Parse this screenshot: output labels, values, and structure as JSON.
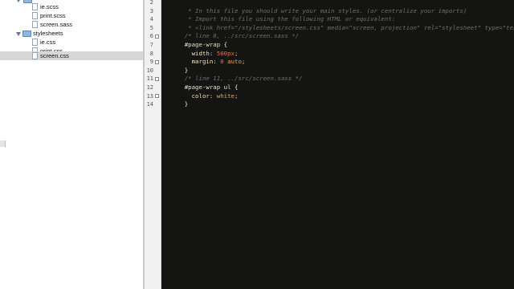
{
  "tree": {
    "items": [
      {
        "label": "ie.scss",
        "kind": "file",
        "depth": 2,
        "selected": false
      },
      {
        "label": "print.scss",
        "kind": "file",
        "depth": 2,
        "selected": false
      },
      {
        "label": "screen.sass",
        "kind": "file",
        "depth": 2,
        "selected": false
      },
      {
        "label": "stylesheets",
        "kind": "folder",
        "depth": 1,
        "selected": false
      },
      {
        "label": "ie.css",
        "kind": "file",
        "depth": 2,
        "selected": false
      },
      {
        "label": "print.css",
        "kind": "file",
        "depth": 2,
        "selected": false
      },
      {
        "label": "screen.css",
        "kind": "file",
        "depth": 2,
        "selected": true
      }
    ]
  },
  "editor": {
    "line_numbers": [
      "2",
      "3",
      "4",
      "5",
      "6",
      "7",
      "8",
      "9",
      "10",
      "11",
      "12",
      "13",
      "14"
    ],
    "lines": {
      "l2": " * In this file you should write your main styles. (or centralize your imports)",
      "l3": " * Import this file using the following HTML or equivalent:",
      "l4": " * <link href=\"/stylesheets/screen.css\" media=\"screen, projection\" rel=\"stylesheet\" type=\"text/css\" /> */",
      "l5": "/* line 8, ../src/screen.sass */",
      "l6_sel": "#page-wrap",
      "l6_brace": " {",
      "l7_prop": "  width: ",
      "l7_val": "500px",
      "l7_end": ";",
      "l8_prop": "  margin: ",
      "l8_val": "0",
      "l8_val2": " auto",
      "l8_end": ";",
      "l9": "}",
      "l10": "/* line 11, ../src/screen.sass */",
      "l11_sel": "#page-wrap ul",
      "l11_brace": " {",
      "l12_prop": "  color: ",
      "l12_val": "white",
      "l12_end": ";",
      "l13": "}"
    }
  }
}
